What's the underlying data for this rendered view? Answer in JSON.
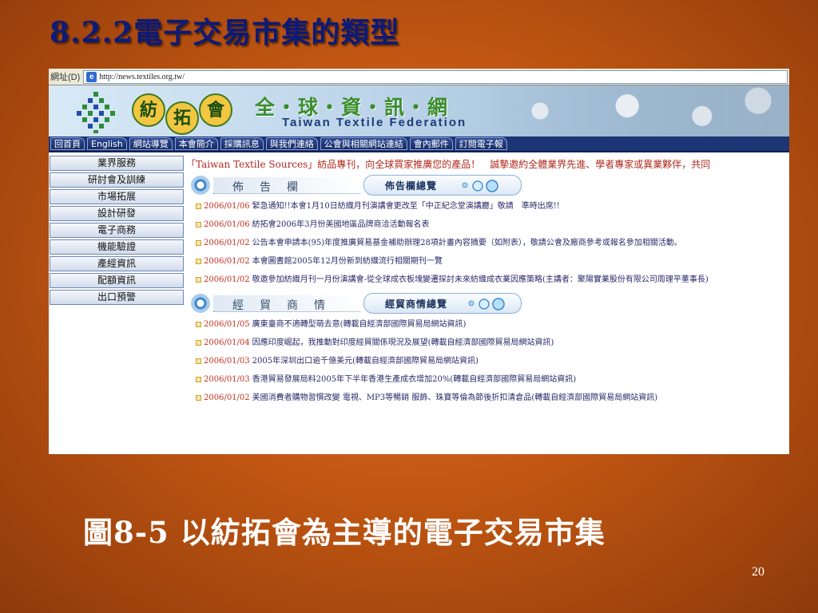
{
  "slide": {
    "title": "8.2.2電子交易市集的類型",
    "caption": "圖8-5  以紡拓會為主導的電子交易市集",
    "page_number": "20"
  },
  "browser": {
    "address_label": "網址(D)",
    "url": "http://news.textiles.org.tw/"
  },
  "site": {
    "seal_chars": [
      "紡",
      "拓",
      "會"
    ],
    "banner_cn": "全・球・資・訊・網",
    "banner_en": "Taiwan Textile Federation",
    "nav": [
      "回首頁",
      "English",
      "網站導覽",
      "本會簡介",
      "採購訊息",
      "與我們連絡",
      "公會與相關網站連結",
      "會內郵件",
      "訂閱電子報"
    ],
    "sidebar": [
      "業界服務",
      "研討會及訓練",
      "市場拓展",
      "設計研發",
      "電子商務",
      "機能驗證",
      "產經資訊",
      "配額資訊",
      "出口預警"
    ],
    "marquee": "「Taiwan Textile Sources」紡品專刊，向全球買家推廣您的產品！　誠摯邀約全體業界先進、學者專家或異業夥伴，共同",
    "sections": [
      {
        "label": "佈告欄",
        "pill": "佈告欄總覽",
        "items": [
          {
            "date": "2006/01/06",
            "text": "緊急通知!!本會1月10日紡織月刊演講會更改至「中正紀念堂演講廳」敬請　準時出席!!"
          },
          {
            "date": "2006/01/06",
            "text": "紡拓會2006年3月份美國地區品牌商洽活動報名表"
          },
          {
            "date": "2006/01/02",
            "text": "公告本會申請本(95)年度推廣貿易基金補助辦理28項計畫內容摘要（如附表），敬請公會及廠商參考或報名參加相關活動。"
          },
          {
            "date": "2006/01/02",
            "text": "本會圖書館2005年12月份新到紡織流行相關期刊一覽"
          },
          {
            "date": "2006/01/02",
            "text": "敬邀參加紡織月刊一月份演講會-從全球成衣板塊變遷探討未來紡織成衣業因應策略(主講者：聚陽實業股份有限公司周理平董事長)"
          }
        ]
      },
      {
        "label": "經貿商情",
        "pill": "經貿商情總覽",
        "items": [
          {
            "date": "2006/01/05",
            "text": "廣東臺商不適轉型萌去意(轉載自經濟部國際貿易局網站資訊)"
          },
          {
            "date": "2006/01/04",
            "text": "因應印度崛起，我推動對印度經貿關係現況及展望(轉載自經濟部國際貿易局網站資訊)"
          },
          {
            "date": "2006/01/03",
            "text": "2005年深圳出口逾千億美元(轉載自經濟部國際貿易局網站資訊)"
          },
          {
            "date": "2006/01/03",
            "text": "香港貿易發展局料2005年下半年香港生產成衣增加20%(轉載自經濟部國際貿易局網站資訊)"
          },
          {
            "date": "2006/01/02",
            "text": "美國消費者購物習慣改變 電視、MP3等暢銷 服飾、珠寶等倫為節後折扣清倉品(轉載自經濟部國際貿易局網站資訊)"
          }
        ]
      }
    ]
  }
}
